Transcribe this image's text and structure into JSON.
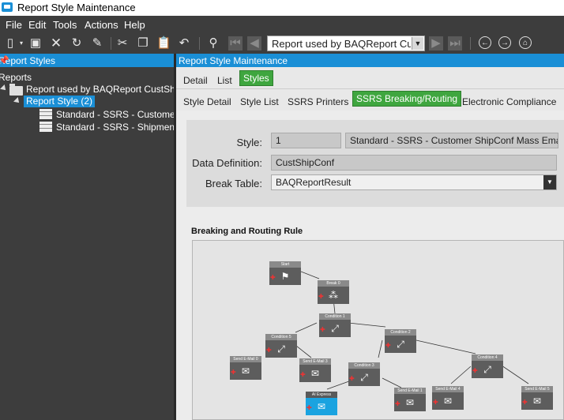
{
  "window": {
    "title": "Report Style Maintenance"
  },
  "menu": [
    "File",
    "Edit",
    "Tools",
    "Actions",
    "Help"
  ],
  "toolbar": {
    "combo_value": "Report used by BAQReport CustS"
  },
  "left_panel": {
    "title": "Report Styles",
    "tree": {
      "root": "Reports",
      "report": "Report used by BAQReport CustShi",
      "style_node": "Report Style (2)",
      "children": [
        "Standard - SSRS - Custome",
        "Standard - SSRS - Shipment"
      ]
    }
  },
  "right_panel": {
    "title": "Report Style Maintenance",
    "tabs": [
      "Detail",
      "List",
      "Styles"
    ],
    "active_tab": "Styles",
    "subtabs": [
      "Style Detail",
      "Style List",
      "SSRS Printers",
      "SSRS Breaking/Routing",
      "Electronic Compliance"
    ],
    "active_subtab": "SSRS Breaking/Routing",
    "form": {
      "style_label": "Style:",
      "style_value": "1",
      "style_desc": "Standard - SSRS - Customer ShipConf Mass Emaili",
      "datadef_label": "Data Definition:",
      "datadef_value": "CustShipConf",
      "breaktable_label": "Break Table:",
      "breaktable_value": "BAQReportResult"
    },
    "rule_title": "Breaking and Routing Rule",
    "nodes": [
      {
        "label": "Start"
      },
      {
        "label": "Break 0"
      },
      {
        "label": "Condition 1"
      },
      {
        "label": "Condition 5"
      },
      {
        "label": "Condition 2"
      },
      {
        "label": "Condition 4"
      },
      {
        "label": "Condition 3"
      },
      {
        "label": "Send E-Mail 0"
      },
      {
        "label": "Send E-Mail 3"
      },
      {
        "label": "AI Express"
      },
      {
        "label": "Send E-Mail 1"
      },
      {
        "label": "Send E-Mail 4"
      },
      {
        "label": "Send E-Mail 5"
      }
    ]
  },
  "colors": {
    "accent": "#1a8fd6",
    "active_tab": "#3fa63f",
    "dark_bg": "#3d3d3d"
  }
}
